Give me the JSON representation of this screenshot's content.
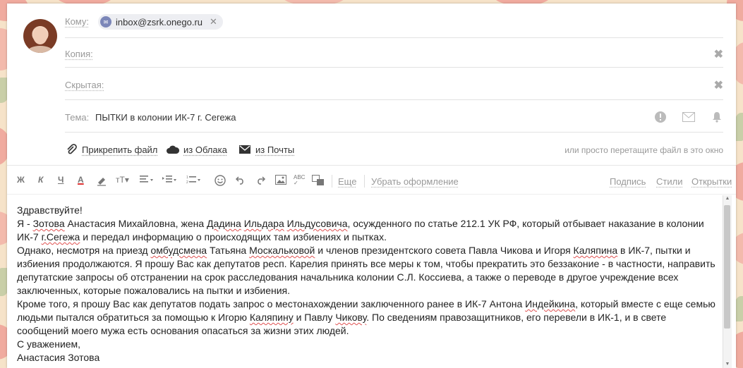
{
  "compose": {
    "to_label": "Кому:",
    "to_chip": "inbox@zsrk.onego.ru",
    "cc_label": "Копия:",
    "bcc_label": "Скрытая:",
    "subject_label": "Тема:",
    "subject_value": "ПЫТКИ в колонии ИК-7 г. Сегежа",
    "remove_glyph": "✖"
  },
  "attach": {
    "file_label": "Прикрепить файл",
    "cloud_label": "из Облака",
    "mail_label": "из Почты",
    "drop_hint": "или просто перетащите файл в это окно"
  },
  "toolbar": {
    "bold": "Ж",
    "italic": "К",
    "underline": "Ч",
    "font_color": "А",
    "more_label": "Еще",
    "clear_format_label": "Убрать оформление",
    "signature_label": "Подпись",
    "styles_label": "Стили",
    "cards_label": "Открытки"
  },
  "body": {
    "greeting": "Здравствуйте!",
    "p1": [
      "Я - ",
      "Зотова",
      " Анастасия Михайловна, жена ",
      "Дадина",
      " ",
      "Ильдара",
      " ",
      "Ильдусовича",
      ", осужденного по статье 212.1 УК РФ, который отбывает наказание в колонии ИК-7 ",
      "г.Сегежа",
      " и передал информацию о происходящих там избиениях и пытках."
    ],
    "p2": [
      "Однако, несмотря на приезд ",
      "омбудсмена",
      " Татьяна ",
      "Москальковой",
      " и членов президентского совета Павла Чикова и Игоря ",
      "Каляпина",
      " в ИК-7, пытки и избиения продолжаются. Я прошу Вас как депутатов респ. Карелия принять все меры к том, чтобы прекратить это беззаконие - в частности, направить депутатские запросы об отстранении на срок расследования начальника колонии С.Л. Коссиева, а также о переводе в другое учреждение всех заключенных, которые пожаловались на пытки и избиения."
    ],
    "p3": [
      "Кроме того, я прошу Вас как депутатов подать запрос о местонахождении заключенного ранее в ИК-7 Антона ",
      "Индейкина",
      ", который вместе с еще семью людьми пытался обратиться за помощью к Игорю ",
      "Каляпину",
      " и Павлу ",
      "Чикову",
      ". По сведениям правозащитников, его перевели в ИК-1, и в свете сообщений моего мужа есть основания опасаться за жизни этих людей."
    ],
    "closing": "С уважением,",
    "signature": "Анастасия Зотова"
  }
}
